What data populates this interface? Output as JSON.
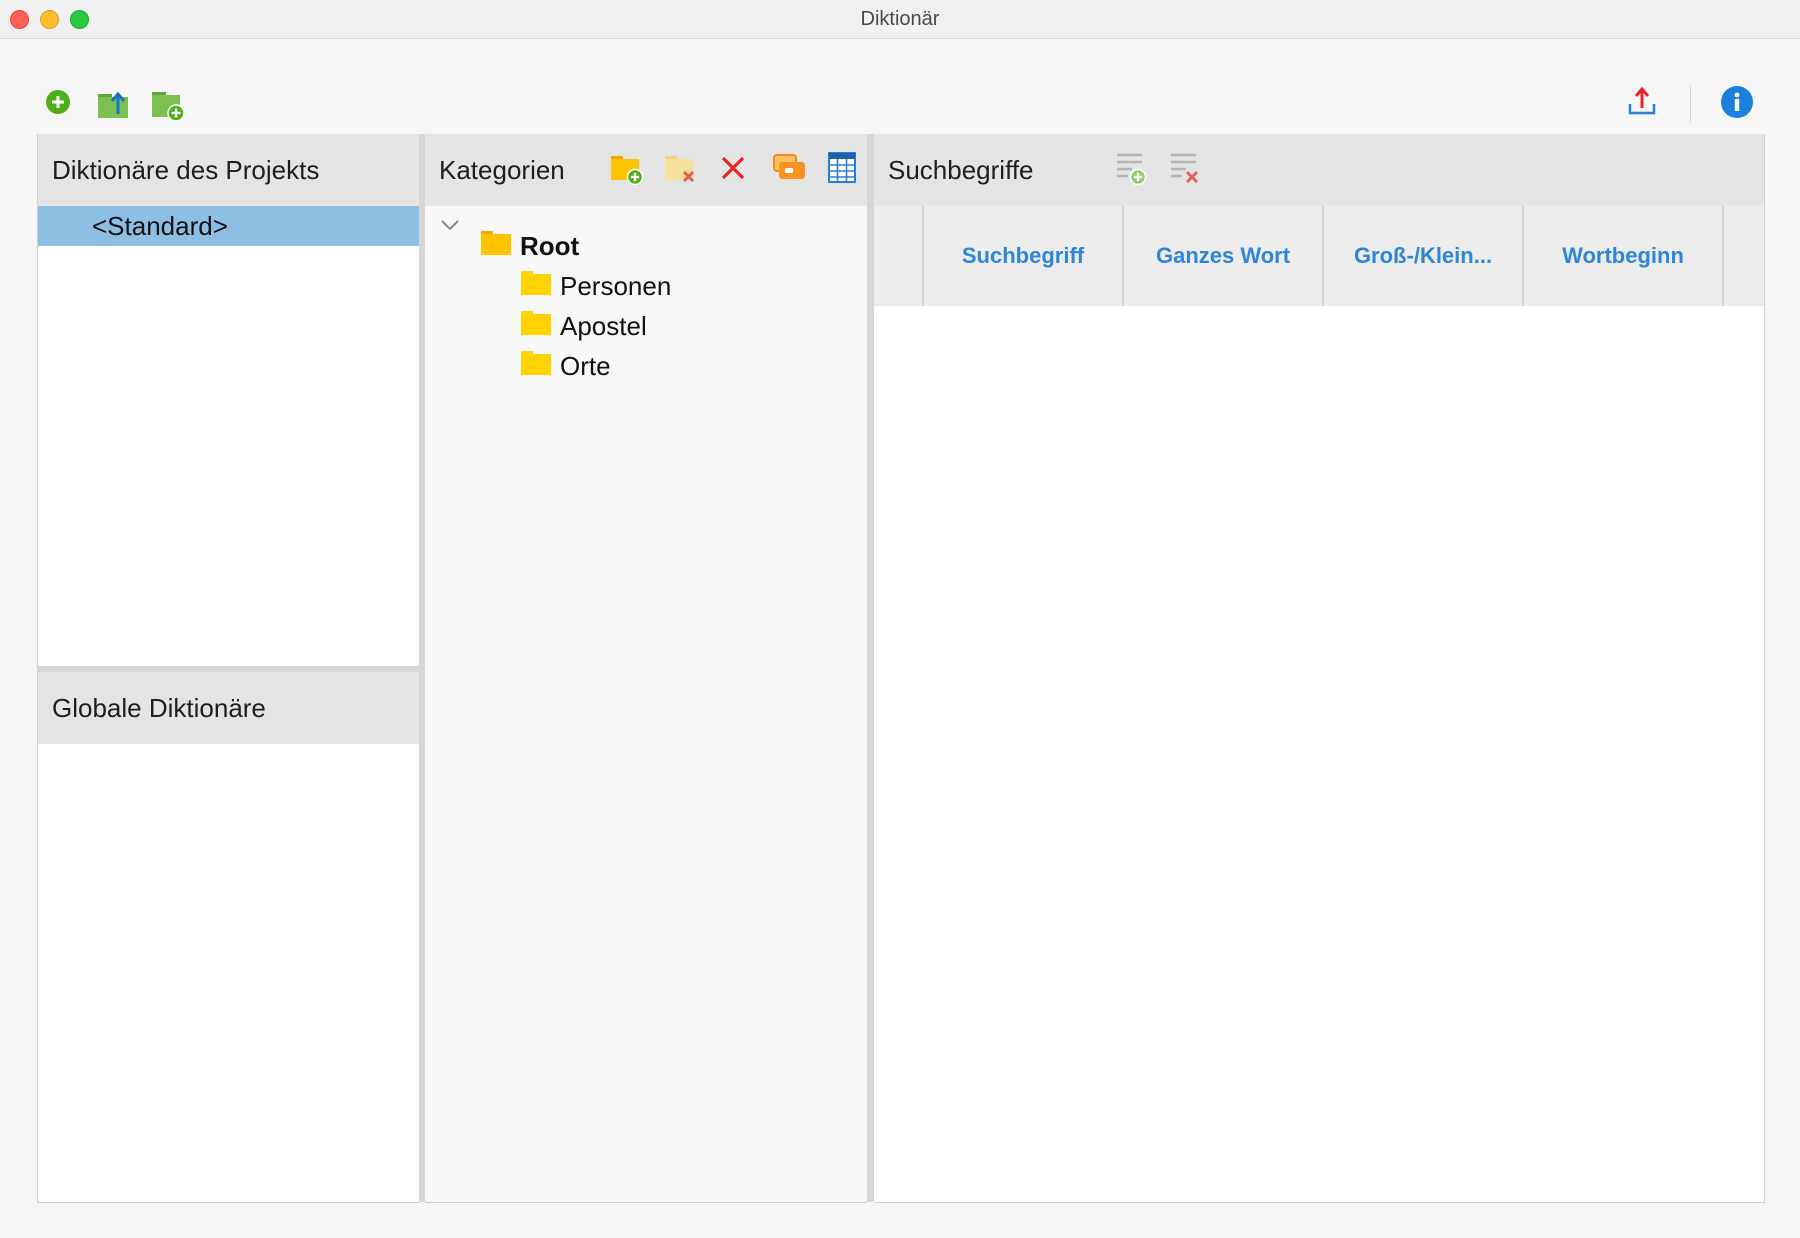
{
  "window": {
    "title": "Diktionär"
  },
  "toolbar": {
    "left_icons": [
      "add-dictionary-icon",
      "import-dictionary-icon",
      "new-dictionary-folder-icon"
    ],
    "right_icons": [
      "export-icon",
      "info-icon"
    ]
  },
  "project_dictionaries": {
    "title": "Diktionäre des Projekts",
    "items": [
      {
        "label": "<Standard>",
        "selected": true
      }
    ]
  },
  "global_dictionaries": {
    "title": "Globale Diktionäre",
    "items": []
  },
  "categories": {
    "title": "Kategorien",
    "tools": [
      "new-category-icon",
      "delete-category-folder-icon",
      "delete-icon",
      "rename-icon",
      "table-icon"
    ],
    "tree": {
      "root": {
        "label": "Root",
        "expanded": true
      },
      "children": [
        {
          "label": "Personen"
        },
        {
          "label": "Apostel"
        },
        {
          "label": "Orte"
        }
      ]
    }
  },
  "search_terms": {
    "title": "Suchbegriffe",
    "tools": [
      "add-search-term-icon",
      "delete-search-term-icon"
    ],
    "columns": [
      "Suchbegriff",
      "Ganzes Wort",
      "Groß-/Klein...",
      "Wortbeginn"
    ],
    "rows": []
  },
  "colors": {
    "selection": "#8cbfe2",
    "column_header_text": "#2f86d8",
    "folder": "#ffd200",
    "accent_green": "#4caf1a",
    "info_blue": "#1b7fdc"
  }
}
